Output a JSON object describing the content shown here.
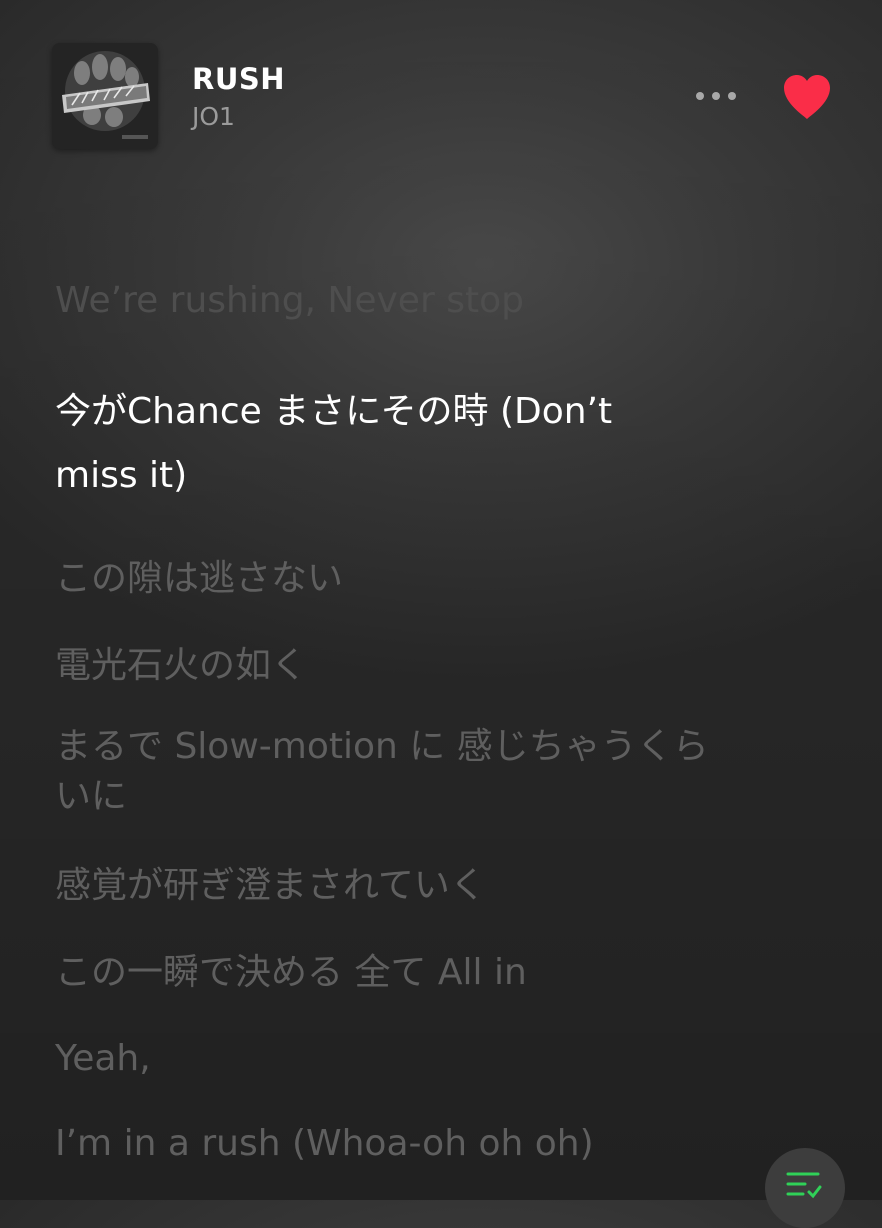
{
  "now_playing": {
    "title": "RUSH",
    "artist": "JO1",
    "liked": true
  },
  "colors": {
    "like_red": "#fa2d48",
    "queue_green": "#30d158",
    "active_lyric": "#ffffff",
    "inactive_lyric": "#5d5d5d"
  },
  "icons": {
    "more": "more-horizontal-icon",
    "like": "heart-icon",
    "queue": "queue-list-icon"
  },
  "lyrics": [
    {
      "text": "We’re rushing, Never stop",
      "state": "past"
    },
    {
      "text": "今がChance まさにその時 (Don’t miss it)",
      "state": "current"
    },
    {
      "text": "この隙は逃さない",
      "state": "upcoming"
    },
    {
      "text": "電光石火の如く",
      "state": "upcoming"
    },
    {
      "text": "まるで Slow-motion に 感じちゃうくらいに",
      "state": "upcoming"
    },
    {
      "text": "感覚が研ぎ澄まされていく",
      "state": "upcoming"
    },
    {
      "text": "この一瞬で決める 全て All in",
      "state": "upcoming"
    },
    {
      "text": "Yeah,",
      "state": "upcoming"
    },
    {
      "text": "I’m in a rush (Whoa-oh oh oh)",
      "state": "upcoming"
    }
  ]
}
